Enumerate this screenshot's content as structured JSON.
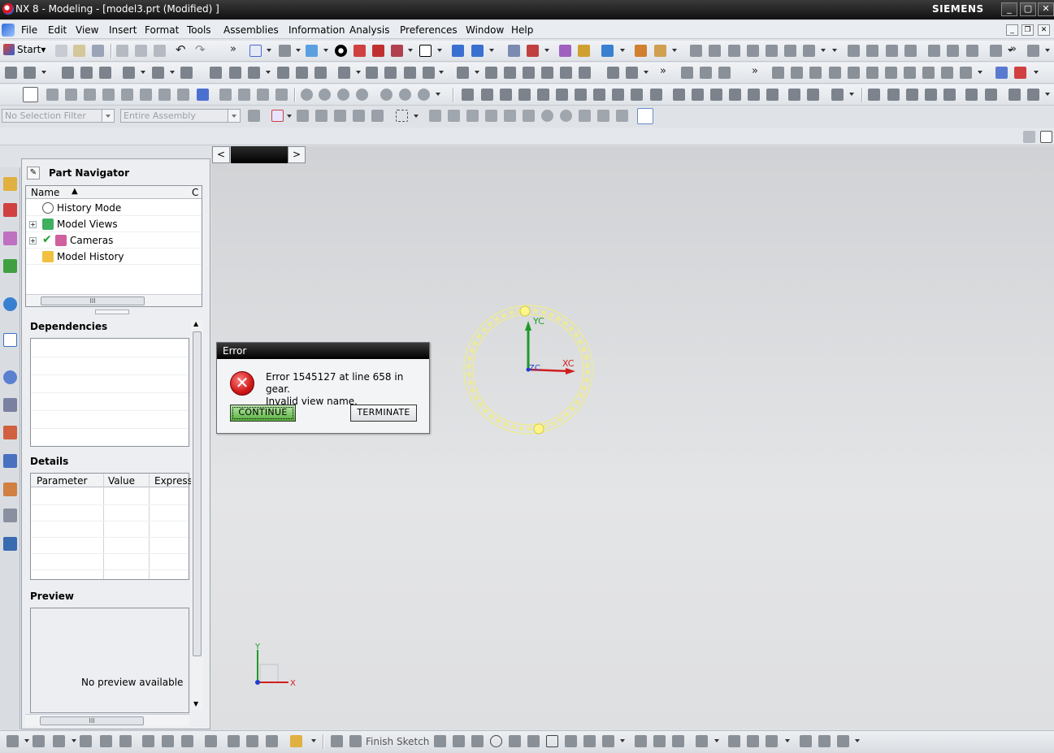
{
  "window": {
    "title": "NX 8 - Modeling - [model3.prt (Modified) ]",
    "brand": "SIEMENS"
  },
  "menu": [
    "File",
    "Edit",
    "View",
    "Insert",
    "Format",
    "Tools",
    "Assemblies",
    "Information",
    "Analysis",
    "Preferences",
    "Window",
    "Help"
  ],
  "toolbar": {
    "start_label": "Start"
  },
  "selection": {
    "filter": "No Selection Filter",
    "scope": "Entire Assembly"
  },
  "navigator": {
    "title": "Part Navigator",
    "columns": [
      "Name",
      "C"
    ],
    "items": [
      "History Mode",
      "Model Views",
      "Cameras",
      "Model History"
    ],
    "dependencies_title": "Dependencies",
    "details_title": "Details",
    "details_columns": [
      "Parameter",
      "Value",
      "Express"
    ],
    "preview_title": "Preview",
    "preview_empty": "No preview available"
  },
  "graphics": {
    "wcs_labels": {
      "x": "XC",
      "y": "YC",
      "z": "ZC"
    },
    "triad_labels": {
      "x": "X",
      "y": "Y"
    }
  },
  "dialog": {
    "title": "Error",
    "message_line1": "Error 1545127 at line 658 in gear.",
    "message_line2": "Invalid view name.",
    "continue_label": "CONTINUE",
    "terminate_label": "TERMINATE"
  },
  "bottom": {
    "finish_sketch": "Finish Sketch"
  },
  "colors": {
    "gear": "#f0ec8a",
    "xc_axis": "#d01e1e",
    "yc_axis": "#1e9a2a",
    "zc_axis": "#2040d0"
  }
}
